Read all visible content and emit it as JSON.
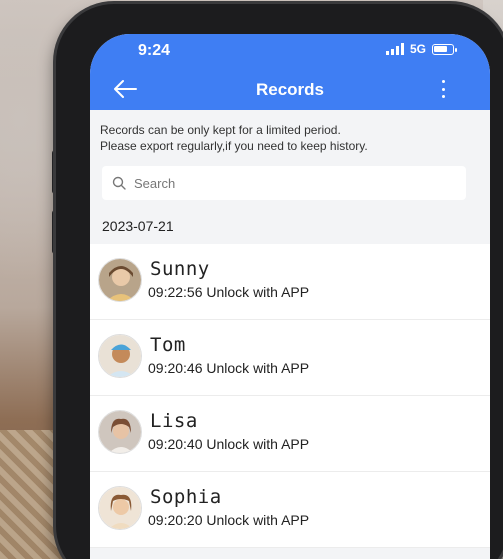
{
  "status_bar": {
    "time": "9:24",
    "network": "5G"
  },
  "header": {
    "title": "Records",
    "back_icon": "arrow-left-icon",
    "more_icon": "more-vertical-icon",
    "color": "#3f7ef3"
  },
  "notice": {
    "line1": "Records can be only kept for a limited period.",
    "line2": "Please export regularly,if you need to keep history."
  },
  "search": {
    "placeholder": "Search",
    "value": ""
  },
  "date_group": "2023-07-21",
  "records": [
    {
      "name": "Sunny",
      "detail": "09:22:56 Unlock with APP",
      "avatar_colors": [
        "#e8c27a",
        "#6a4a30"
      ]
    },
    {
      "name": "Tom",
      "detail": "09:20:46 Unlock with APP",
      "avatar_colors": [
        "#4aa3d8",
        "#c48a5a"
      ]
    },
    {
      "name": "Lisa",
      "detail": "09:20:40 Unlock with APP",
      "avatar_colors": [
        "#d9cfc7",
        "#7a4e35"
      ]
    },
    {
      "name": "Sophia",
      "detail": "09:20:20 Unlock with APP",
      "avatar_colors": [
        "#f0dcc0",
        "#8a5a35"
      ]
    }
  ]
}
